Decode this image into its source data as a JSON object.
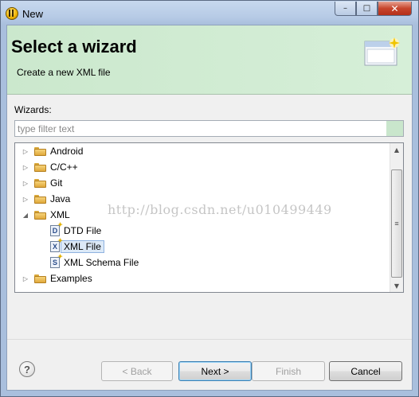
{
  "window": {
    "title": "New",
    "icon": "eclipse-icon",
    "controls": {
      "minimize": "–",
      "maximize": "□",
      "close": "✕"
    }
  },
  "banner": {
    "title": "Select a wizard",
    "subtitle": "Create a new XML file",
    "image": "new-wizard-banner-icon"
  },
  "wizards": {
    "label": "Wizards:",
    "filter_placeholder": "type filter text",
    "tree": [
      {
        "label": "Android",
        "type": "folder",
        "expanded": false,
        "level": 0
      },
      {
        "label": "C/C++",
        "type": "folder",
        "expanded": false,
        "level": 0
      },
      {
        "label": "Git",
        "type": "folder",
        "expanded": false,
        "level": 0
      },
      {
        "label": "Java",
        "type": "folder",
        "expanded": false,
        "level": 0
      },
      {
        "label": "XML",
        "type": "folder",
        "expanded": true,
        "level": 0
      },
      {
        "label": "DTD File",
        "type": "file",
        "glyph": "D",
        "level": 1
      },
      {
        "label": "XML File",
        "type": "file",
        "glyph": "X",
        "level": 1,
        "selected": true
      },
      {
        "label": "XML Schema File",
        "type": "file",
        "glyph": "S",
        "level": 1
      },
      {
        "label": "Examples",
        "type": "folder",
        "expanded": false,
        "level": 0
      }
    ],
    "twisty_collapsed": "▷",
    "twisty_expanded": "◢",
    "watermark": "http://blog.csdn.net/u010499449"
  },
  "scrollbar": {
    "up": "▲",
    "down": "▼",
    "grip": "≡"
  },
  "buttons": {
    "help": "?",
    "back": "< Back",
    "next": "Next >",
    "finish": "Finish",
    "cancel": "Cancel"
  }
}
